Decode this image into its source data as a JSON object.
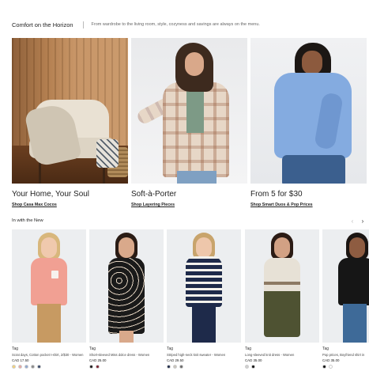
{
  "header": {
    "title": "Comfort on the Horizon",
    "subtitle": "From wardrobe to the living room, style, cozyness and savings are always on the menu."
  },
  "promos": [
    {
      "heading": "Your Home, Your Soul",
      "link": "Shop Casa Max Cocos"
    },
    {
      "heading": "Soft-à-Porter",
      "link": "Shop Layering Pieces"
    },
    {
      "heading": "From 5 for $30",
      "link": "Shop Smart Duos & Pop Prices"
    }
  ],
  "new_section": {
    "label": "In with the New",
    "prev_arrow": "‹",
    "next_arrow": "›"
  },
  "products": [
    {
      "brand": "Tag",
      "name": "Scrat days, Cotton pocket t-shirt, 2/$30 - Women",
      "price": "CAD 17.50",
      "swatches": [
        "#f3d27a",
        "#e8a7a2",
        "#8fa7cf",
        "#8a8a8a",
        "#3a4a6a"
      ]
    },
    {
      "brand": "Tag",
      "name": "Short-sleeved Miss dolce dress - Women",
      "price": "CAD 25.00",
      "swatches": [
        "#1a1a1a",
        "#7b2230"
      ]
    },
    {
      "brand": "Tag",
      "name": "Striped high-neck knit sweater - Women",
      "price": "CAD 29.50",
      "swatches": [
        "#1e2a4a",
        "#c9c4bb",
        "#6b6b6b"
      ]
    },
    {
      "brand": "Tag",
      "name": "Long-sleeved knit dress - Women",
      "price": "CAD 35.00",
      "swatches": [
        "#cfcfcf",
        "#111111"
      ]
    },
    {
      "brand": "Tag",
      "name": "Pop prices, Boyfriend shirt in",
      "price": "CAD 35.00",
      "swatches": [
        "#111111",
        "#ffffff"
      ]
    }
  ]
}
